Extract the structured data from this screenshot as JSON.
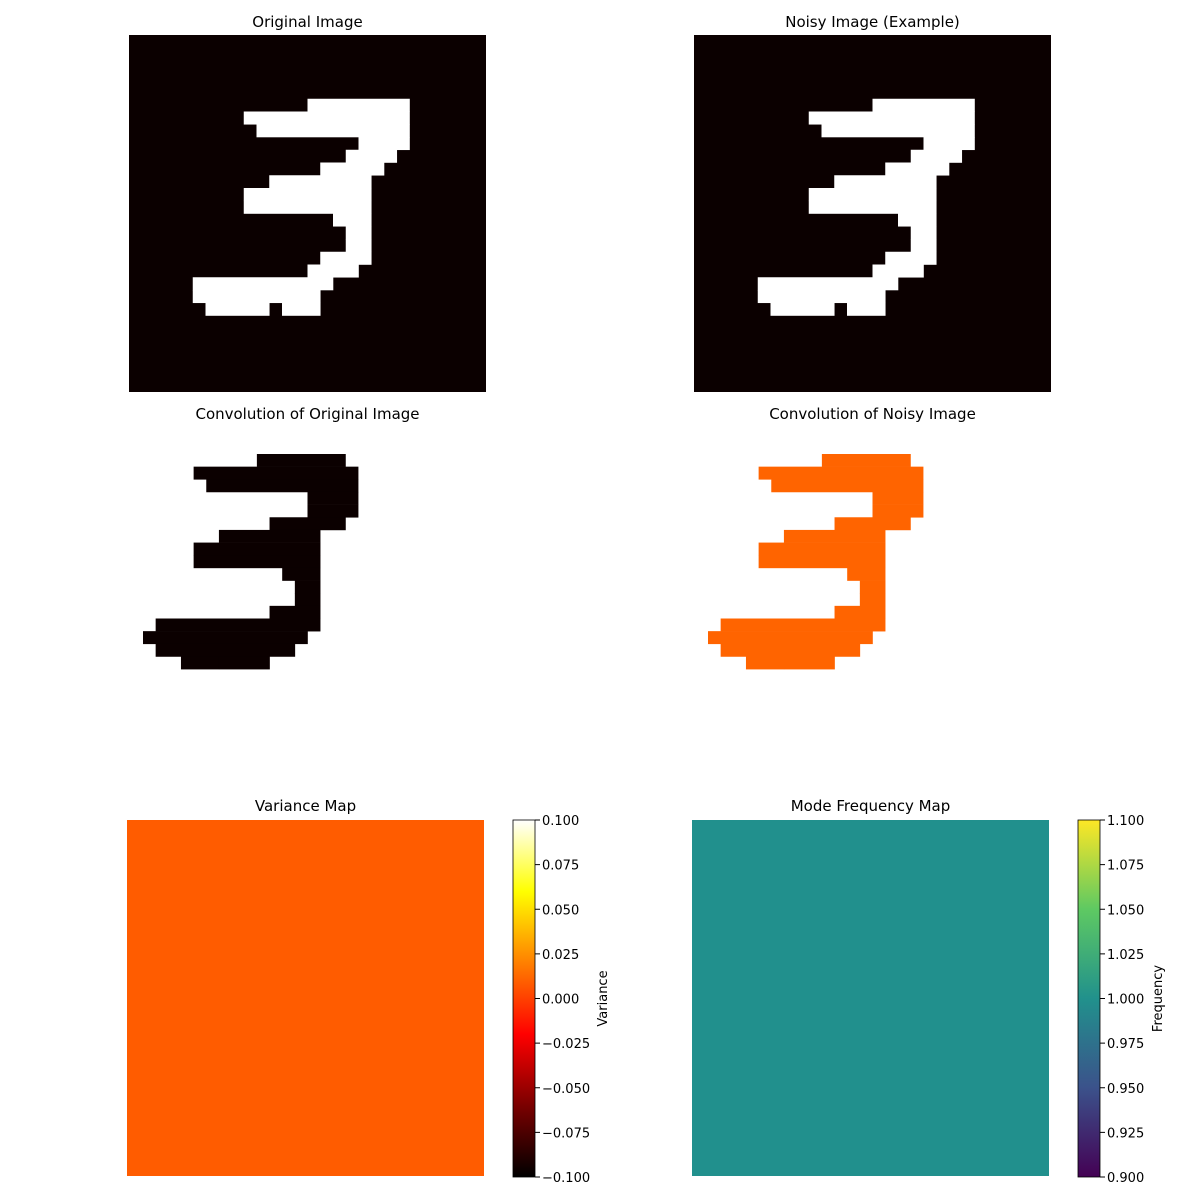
{
  "chart_data": [
    {
      "type": "heatmap",
      "title": "Original Image",
      "colormap": "hot",
      "background_color": "#0b0000",
      "foreground_color": "#ffffff",
      "axes": "off",
      "grid_size": [
        28,
        28
      ],
      "shape": "digit-3",
      "pixel_runs": [
        [
          5,
          14,
          21
        ],
        [
          6,
          9,
          21
        ],
        [
          7,
          10,
          21
        ],
        [
          8,
          18,
          21
        ],
        [
          9,
          17,
          20
        ],
        [
          10,
          15,
          19
        ],
        [
          11,
          11,
          18
        ],
        [
          12,
          9,
          18
        ],
        [
          13,
          9,
          18
        ],
        [
          14,
          16,
          18
        ],
        [
          15,
          17,
          18
        ],
        [
          16,
          17,
          18
        ],
        [
          17,
          15,
          18
        ],
        [
          18,
          14,
          17
        ],
        [
          19,
          5,
          15
        ],
        [
          20,
          5,
          14
        ],
        [
          21,
          6,
          10
        ],
        [
          21,
          12,
          14
        ]
      ]
    },
    {
      "type": "heatmap",
      "title": "Noisy Image (Example)",
      "colormap": "hot",
      "background_color": "#0b0000",
      "foreground_color": "#ffffff",
      "axes": "off",
      "grid_size": [
        28,
        28
      ],
      "shape": "digit-3",
      "pixel_runs": [
        [
          5,
          14,
          21
        ],
        [
          6,
          9,
          21
        ],
        [
          7,
          10,
          21
        ],
        [
          8,
          18,
          21
        ],
        [
          9,
          17,
          20
        ],
        [
          10,
          15,
          19
        ],
        [
          11,
          11,
          18
        ],
        [
          12,
          9,
          18
        ],
        [
          13,
          9,
          18
        ],
        [
          14,
          16,
          18
        ],
        [
          15,
          17,
          18
        ],
        [
          16,
          17,
          18
        ],
        [
          17,
          15,
          18
        ],
        [
          18,
          14,
          17
        ],
        [
          19,
          5,
          15
        ],
        [
          20,
          5,
          14
        ],
        [
          21,
          6,
          10
        ],
        [
          21,
          12,
          14
        ]
      ]
    },
    {
      "type": "heatmap",
      "title": "Convolution of Original Image",
      "colormap": "hot",
      "background_color": "#ffffff",
      "foreground_color": "#0b0000",
      "axes": "off",
      "grid_size": [
        26,
        26
      ],
      "shape": "digit-3",
      "pixel_runs": [
        [
          0,
          9,
          15
        ],
        [
          1,
          4,
          16
        ],
        [
          2,
          5,
          16
        ],
        [
          3,
          13,
          16
        ],
        [
          4,
          13,
          16
        ],
        [
          5,
          10,
          15
        ],
        [
          6,
          6,
          13
        ],
        [
          7,
          4,
          13
        ],
        [
          8,
          4,
          13
        ],
        [
          9,
          11,
          13
        ],
        [
          10,
          12,
          13
        ],
        [
          11,
          12,
          13
        ],
        [
          12,
          10,
          13
        ],
        [
          13,
          1,
          13
        ],
        [
          14,
          0,
          12
        ],
        [
          15,
          1,
          11
        ],
        [
          16,
          3,
          5
        ],
        [
          16,
          6,
          9
        ]
      ]
    },
    {
      "type": "heatmap",
      "title": "Convolution of Noisy Image",
      "colormap": "hot",
      "background_color": "#ffffff",
      "foreground_color": "#ff6400",
      "axes": "off",
      "grid_size": [
        26,
        26
      ],
      "shape": "digit-3",
      "pixel_runs": [
        [
          0,
          9,
          15
        ],
        [
          1,
          4,
          16
        ],
        [
          2,
          5,
          16
        ],
        [
          3,
          13,
          16
        ],
        [
          4,
          13,
          16
        ],
        [
          5,
          10,
          15
        ],
        [
          6,
          6,
          13
        ],
        [
          7,
          4,
          13
        ],
        [
          8,
          4,
          13
        ],
        [
          9,
          11,
          13
        ],
        [
          10,
          12,
          13
        ],
        [
          11,
          12,
          13
        ],
        [
          12,
          10,
          13
        ],
        [
          13,
          1,
          13
        ],
        [
          14,
          0,
          12
        ],
        [
          15,
          1,
          11
        ],
        [
          16,
          3,
          5
        ],
        [
          16,
          6,
          9
        ]
      ]
    },
    {
      "type": "heatmap",
      "title": "Variance Map",
      "colormap": "hot",
      "fill_color": "#ff5c00",
      "value": 0,
      "axes": "off",
      "colorbar": {
        "label": "Variance",
        "vmin": -0.1,
        "vmax": 0.1,
        "ticks": [
          "0.100",
          "0.075",
          "0.050",
          "0.025",
          "0.000",
          "−0.025",
          "−0.050",
          "−0.075",
          "−0.100"
        ],
        "colors": [
          "#000000",
          "#7a0000",
          "#ff0000",
          "#ff8000",
          "#ffff00",
          "#ffffff"
        ]
      }
    },
    {
      "type": "heatmap",
      "title": "Mode Frequency Map",
      "colormap": "viridis",
      "fill_color": "#21908d",
      "value": 1,
      "axes": "off",
      "colorbar": {
        "label": "Frequency",
        "vmin": 0.9,
        "vmax": 1.1,
        "ticks": [
          "1.100",
          "1.075",
          "1.050",
          "1.025",
          "1.000",
          "0.975",
          "0.950",
          "0.925",
          "0.900"
        ],
        "colors": [
          "#440154",
          "#3b528b",
          "#21918c",
          "#5ec962",
          "#fde725"
        ]
      }
    }
  ]
}
